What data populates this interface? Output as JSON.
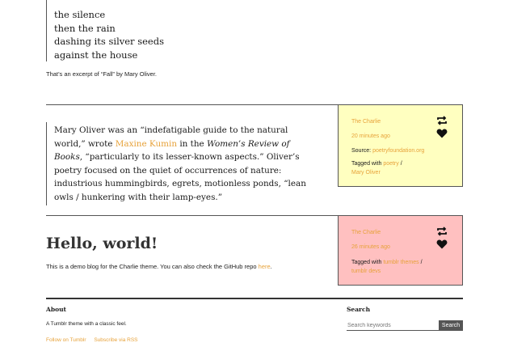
{
  "excerpt": {
    "lines": [
      "the silence",
      "then the rain",
      "dashing its silver seeds",
      "against the house"
    ],
    "note": "That’s an excerpt of “Fall” by Mary Oliver."
  },
  "post_quote": {
    "part1": "Mary Oliver was an “indefatigable guide to the natural world,” wrote ",
    "link": "Maxine Kumin",
    "part2": " in the ",
    "em": "Women’s Review of Books",
    "part3": ", “particularly to its lesser-known aspects.” Oliver’s poetry focused on the quiet of occurrences of nature: industrious hummingbirds, egrets, motionless ponds, “lean owls / hunkering with their lamp-eyes.”"
  },
  "meta_yellow": {
    "author": "The Charlie",
    "time": "20 minutes ago",
    "source_label": "Source: ",
    "source_link": "poetryfoundation.org",
    "tagged_label": "Tagged with ",
    "tag1": "poetry",
    "sep": " /",
    "tag2": "Mary Oliver",
    "bg": "#ffffc0"
  },
  "meta_pink": {
    "author": "The Charlie",
    "time": "26 minutes ago",
    "tagged_label": "Tagged with ",
    "tag1": "tumblr themes",
    "sep": " /",
    "tag2": "tumblr devs",
    "bg": "#ffc0c0"
  },
  "hello": {
    "title": "Hello, world!",
    "text": "This is a demo blog for the Charlie theme. You can also check the GitHub repo ",
    "link": "here",
    "end": "."
  },
  "footer": {
    "about_title": "About",
    "about_text": "A Tumblr theme with a classic feel.",
    "follow": "Follow on Tumblr",
    "rss": "Subscribe via RSS",
    "search_title": "Search",
    "search_placeholder": "Search keywords",
    "search_button": "Search"
  },
  "icons": [
    "reblog-icon",
    "heart-icon"
  ],
  "colors": {
    "accent": "#e7a23a",
    "yellow": "#ffffc0",
    "pink": "#ffc0c0"
  }
}
